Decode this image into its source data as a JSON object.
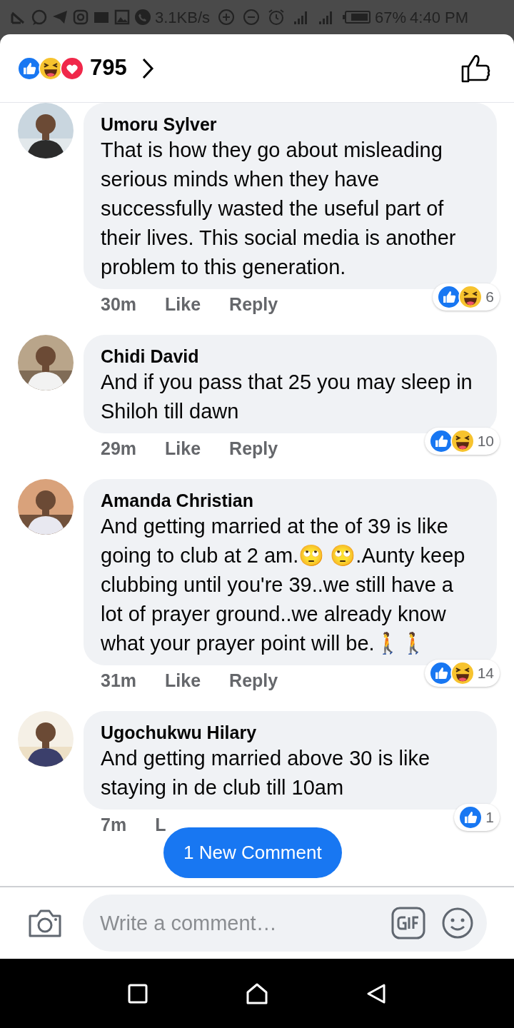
{
  "status_bar": {
    "speed": "3.1KB/s",
    "battery": "67%",
    "time": "4:40 PM"
  },
  "reactions_header": {
    "reactions": [
      {
        "kind": "like"
      },
      {
        "kind": "haha"
      },
      {
        "kind": "love"
      }
    ],
    "count": "795"
  },
  "comments": [
    {
      "name": "Umoru Sylver",
      "text": "That is how they go about misleading serious minds when they have successfully wasted the useful part of their lives. This social media is another problem to this generation.",
      "time": "30m",
      "actions": [
        "Like",
        "Reply"
      ],
      "reactions": [
        {
          "kind": "like"
        },
        {
          "kind": "haha"
        }
      ],
      "reaction_count": "6"
    },
    {
      "name": "Chidi David",
      "text": "And if you pass that 25 you may sleep in Shiloh till dawn",
      "time": "29m",
      "actions": [
        "Like",
        "Reply"
      ],
      "reactions": [
        {
          "kind": "like"
        },
        {
          "kind": "haha"
        }
      ],
      "reaction_count": "10"
    },
    {
      "name": "Amanda Christian",
      "text": "And getting married at the of 39 is like going to club at 2 am.🙄 🙄.Aunty keep clubbing until you're 39..we still have a lot of prayer ground..we already know what your prayer point will be.🚶🚶",
      "time": "31m",
      "actions": [
        "Like",
        "Reply"
      ],
      "reactions": [
        {
          "kind": "like"
        },
        {
          "kind": "haha"
        }
      ],
      "reaction_count": "14"
    },
    {
      "name": "Ugochukwu Hilary",
      "text": "And getting married above 30 is like staying in de club till 10am",
      "time": "7m",
      "actions": [
        "L"
      ],
      "reactions": [
        {
          "kind": "like"
        }
      ],
      "reaction_count": "1"
    }
  ],
  "new_comment_button": "1 New Comment",
  "composer": {
    "placeholder": "Write a comment…"
  }
}
